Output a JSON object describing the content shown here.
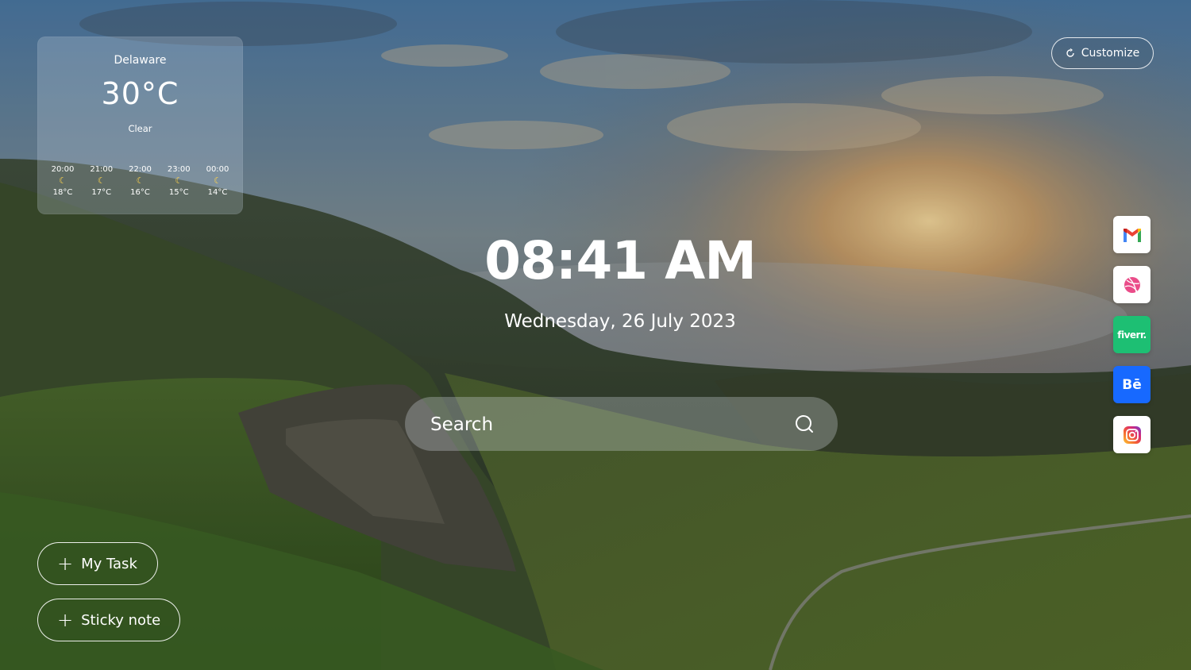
{
  "weather": {
    "location": "Delaware",
    "temperature": "30°C",
    "condition": "Clear",
    "hourly": [
      {
        "time": "20:00",
        "icon": "moon-icon",
        "temp": "18°C"
      },
      {
        "time": "21:00",
        "icon": "moon-icon",
        "temp": "17°C"
      },
      {
        "time": "22:00",
        "icon": "moon-icon",
        "temp": "16°C"
      },
      {
        "time": "23:00",
        "icon": "moon-icon",
        "temp": "15°C"
      },
      {
        "time": "00:00",
        "icon": "moon-icon",
        "temp": "14°C"
      }
    ]
  },
  "customize": {
    "label": "Customize",
    "icon": "refresh-icon"
  },
  "clock": {
    "time": "08:41 AM",
    "date": "Wednesday, 26 July 2023"
  },
  "search": {
    "placeholder": "Search",
    "icon": "search-icon"
  },
  "apps": [
    {
      "name": "Gmail",
      "icon": "gmail-icon",
      "color": "#ffffff"
    },
    {
      "name": "Dribbble",
      "icon": "dribbble-icon",
      "color": "#ea4c89"
    },
    {
      "name": "Fiverr",
      "icon": "fiverr-icon",
      "text": "fiverr.",
      "color": "#1dbf73"
    },
    {
      "name": "Behance",
      "icon": "behance-icon",
      "text": "Bē",
      "color": "#1769ff"
    },
    {
      "name": "Instagram",
      "icon": "instagram-icon",
      "color": "#e1306c"
    }
  ],
  "actions": {
    "my_task": "My Task",
    "sticky_note": "Sticky note",
    "plus": "+"
  }
}
